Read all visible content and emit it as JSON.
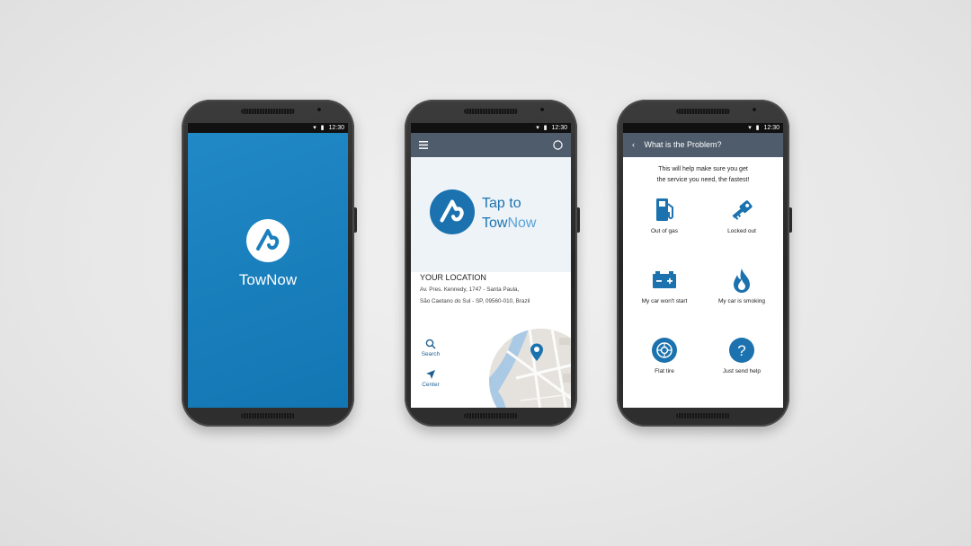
{
  "status_bar": {
    "time": "12:30"
  },
  "splash": {
    "app_name": "TowNow",
    "brand_color": "#1a7fbd"
  },
  "home": {
    "hero_line1": "Tap to",
    "hero_line2_a": "Tow",
    "hero_line2_b": "Now",
    "location_title": "YOUR LOCATION",
    "address_line1": "Av. Pres. Kennedy, 1747 - Santa Paula,",
    "address_line2": "São Caetano do Sul - SP, 09560-010, Brazil",
    "search_label": "Search",
    "center_label": "Center",
    "menu_icon": "hamburger-icon",
    "compass_icon": "compass-icon"
  },
  "problem": {
    "title": "What is the Problem?",
    "subtitle_line1": "This will help make sure you get",
    "subtitle_line2": "the service you need, the fastest!",
    "options": [
      {
        "label": "Out of gas",
        "icon": "fuel-pump-icon"
      },
      {
        "label": "Locked out",
        "icon": "key-icon"
      },
      {
        "label": "My car won't start",
        "icon": "battery-icon"
      },
      {
        "label": "My car is smoking",
        "icon": "flame-icon"
      },
      {
        "label": "Flat tire",
        "icon": "tire-icon"
      },
      {
        "label": "Just send help",
        "icon": "question-icon"
      }
    ]
  },
  "colors": {
    "accent": "#1b72ae",
    "appbar": "#4f5c6c",
    "hero_bg": "#eef3f8"
  }
}
